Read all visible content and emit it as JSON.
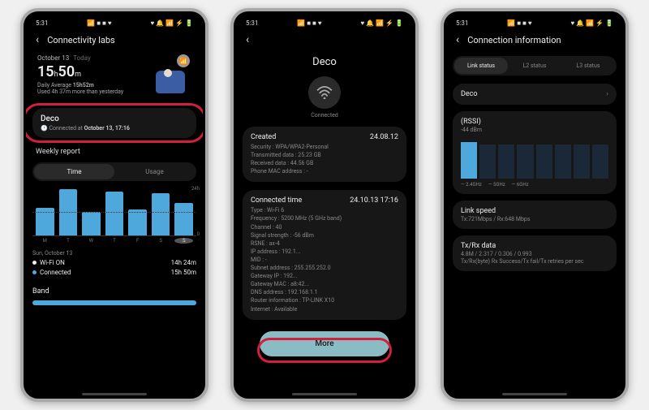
{
  "status": {
    "time": "5:31",
    "left_icons": "📶 ■ ■ ♥",
    "right_icons": "♥ 🔔 📶 ⚡ 🔋"
  },
  "p1": {
    "title": "Connectivity labs",
    "date": "October 13",
    "today": "Today",
    "big_h": "15",
    "big_h_unit": "h",
    "big_m": "50",
    "big_m_unit": "m",
    "avg_label": "Daily Average",
    "avg_value": "15h52m",
    "used": "Used 4h 37m more than yesterday",
    "card": {
      "title": "Deco",
      "sub_prefix": "🕐 Connected at",
      "sub_value": "October 13, 17:16"
    },
    "weekly": "Weekly report",
    "tab_time": "Time",
    "tab_usage": "Usage",
    "y_top": "24h",
    "y_bot": "0",
    "days": [
      "M",
      "T",
      "W",
      "T",
      "F",
      "S",
      "S"
    ],
    "leg_date": "Sun, October 13",
    "wifi_on": "Wi-Fi ON",
    "wifi_on_v": "14h 24m",
    "connected": "Connected",
    "connected_v": "15h 50m",
    "band": "Band"
  },
  "p2": {
    "ssid": "Deco",
    "status": "Connected",
    "created": {
      "label": "Created",
      "value": "24.08.12",
      "l1": "Security : WPA/WPA2-Personal",
      "l2": "Transmitted data : 25.23 GB",
      "l3": "Received data : 44.56 GB",
      "l4": "Phone MAC address : -"
    },
    "conntime": {
      "label": "Connected time",
      "value": "24.10.13 17:16",
      "l1": "Type : Wi-Fi 6",
      "l2": "Frequency : 5200 MHz (5 GHz band)",
      "l3": "Channel : 40",
      "l4": "Signal strength : -56 dBm",
      "l5": "RSNE : ax-4",
      "l6": "IP address : 192.1...",
      "l7": "MID : -",
      "l8": "Subnet address : 255.255.252.0",
      "l9": "Gateway IP : 192...",
      "l10": "Gateway MAC : a8:42...",
      "l11": "DNS address : 192.168.1.1",
      "l12": "Router information : TP-LINK X10",
      "l13": "Internet : Available"
    },
    "more": "More"
  },
  "p3": {
    "title": "Connection information",
    "tab1": "Link status",
    "tab2": "L2 status",
    "tab3": "L3 status",
    "deco": "Deco",
    "rssi": "(RSSI)",
    "rssi_sub": "-44 dBm",
    "leg1": "— 2.4GHz",
    "leg2": "— 5GHz",
    "leg3": "— 6GHz",
    "linkspeed": "Link speed",
    "linkspeed_sub": "Tx:721Mbps / Rx:648 Mbps",
    "txrx": "Tx/Rx data",
    "txrx_sub": "4.8M / 2.317 / 0.306 / 0.993",
    "txrx_sub2": "Tx/Rx(byte)  Rx Success/Tx fail/Tx retries per sec"
  },
  "chart_data": {
    "type": "bar",
    "categories": [
      "M",
      "T",
      "W",
      "T",
      "F",
      "S",
      "S"
    ],
    "values": [
      14,
      23,
      12,
      22,
      13,
      21,
      16
    ],
    "ylim": [
      0,
      24
    ],
    "ylabel": "hours"
  }
}
